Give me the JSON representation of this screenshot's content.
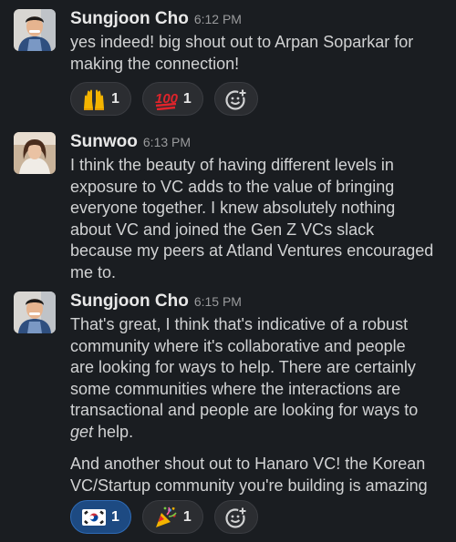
{
  "messages": [
    {
      "user": "Sungjoon Cho",
      "time": "6:12 PM",
      "text": "yes indeed! big shout out to Arpan Soparkar for\nmaking the connection!",
      "reactions": [
        {
          "emoji": "raised-hands-icon",
          "count": "1"
        },
        {
          "emoji": "hundred-points-icon",
          "count": "1"
        }
      ]
    },
    {
      "user": "Sunwoo",
      "time": "6:13 PM",
      "text": "I think the beauty of having different levels in\nexposure to VC adds to the value of bringing\neveryone together. I knew absolutely nothing\nabout VC and joined the Gen Z VCs slack\nbecause my peers at Atland Ventures encouraged\nme to."
    },
    {
      "user": "Sungjoon Cho",
      "time": "6:15 PM",
      "text_before_em": "That's great, I think that's indicative of a robust\ncommunity where it's collaborative and people\nare looking for ways to help. There are certainly\nsome communities where the interactions are\ntransactional and people are looking for ways to\n",
      "text_em": "get",
      "text_after_em": " help.",
      "text2": "And another shout out to Hanaro VC! the Korean\nVC/Startup community you're building is amazing",
      "reactions": [
        {
          "emoji": "south-korea-flag-icon",
          "count": "1",
          "active": true
        },
        {
          "emoji": "party-popper-icon",
          "count": "1"
        }
      ]
    }
  ],
  "colors": {
    "background": "#1a1d21",
    "text": "#d1d2d3",
    "username": "#e8e8e8",
    "timestamp": "#9a9b9d",
    "reaction_bg": "#2b2d31",
    "reaction_active_bg": "#1d4a82"
  }
}
